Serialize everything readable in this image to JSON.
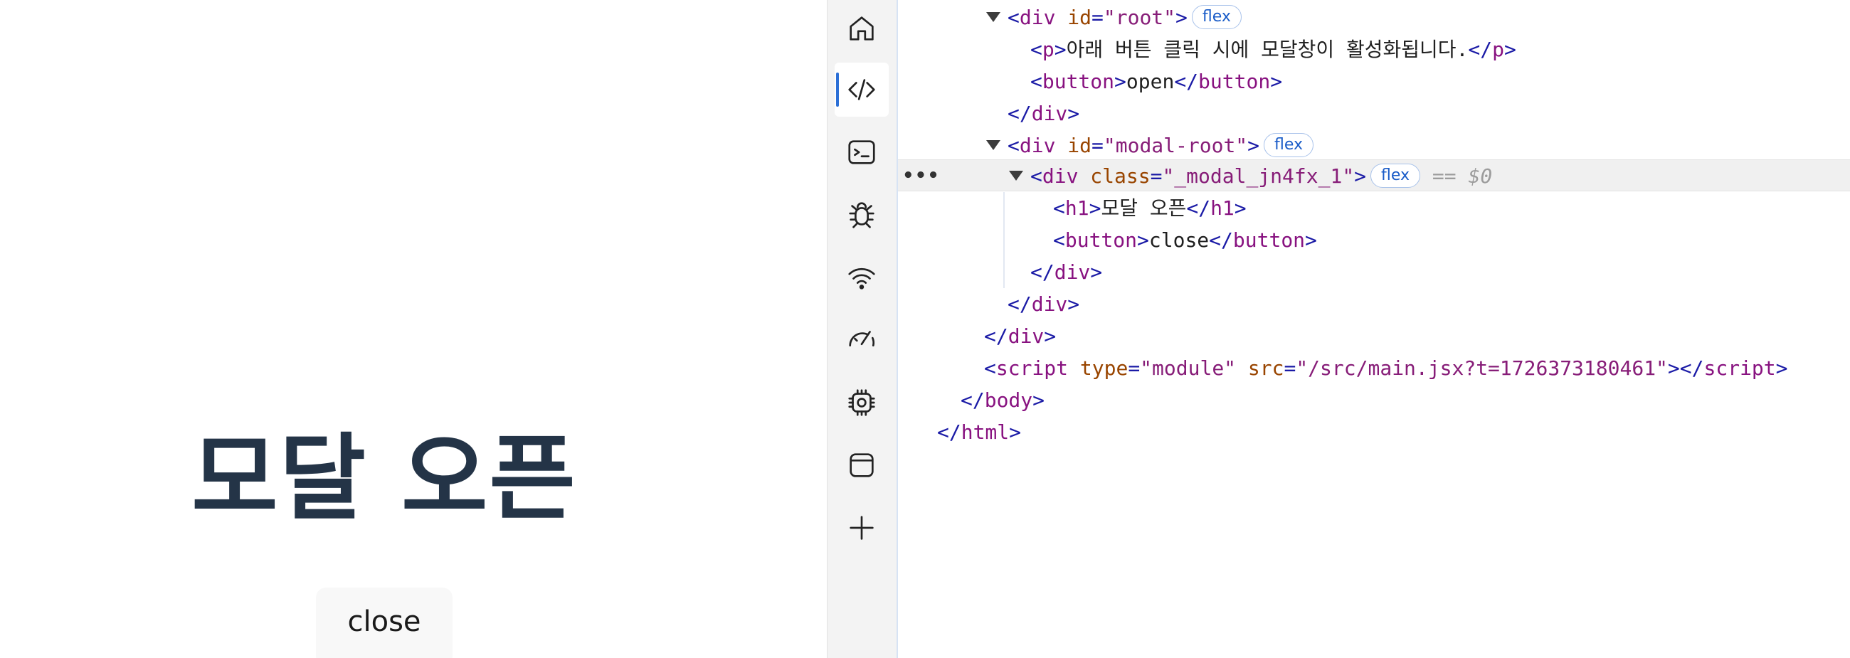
{
  "page": {
    "modal_title": "모달 오픈",
    "close_button": "close"
  },
  "activity_bar": {
    "items": [
      {
        "icon": "home-icon",
        "active": false
      },
      {
        "icon": "code-icon",
        "active": true
      },
      {
        "icon": "console-icon",
        "active": false
      },
      {
        "icon": "bug-icon",
        "active": false
      },
      {
        "icon": "wifi-icon",
        "active": false
      },
      {
        "icon": "performance-icon",
        "active": false
      },
      {
        "icon": "memory-chip-icon",
        "active": false
      },
      {
        "icon": "application-icon",
        "active": false
      },
      {
        "icon": "plus-icon",
        "active": false
      }
    ]
  },
  "elements": {
    "selected_marker": "== $0",
    "badge_label": "flex",
    "dots": "•••",
    "lines": {
      "root_open_id": "\"root\"",
      "p_text": "아래 버튼 클릭 시에 모달창이 활성화됩니다.",
      "button_open_text": "open",
      "modal_root_id": "\"modal-root\"",
      "modal_class": "\"_modal_jn4fx_1\"",
      "h1_text": "모달 오픈",
      "button_close_text": "close",
      "script_type": "\"module\"",
      "script_src": "\"/src/main.jsx?t=1726373180461\""
    }
  },
  "colors": {
    "title": "#243447",
    "accent": "#2b6fd6",
    "tag": "#1a1aa6",
    "tagname": "#881280",
    "attr": "#994500",
    "value": "#871d78"
  }
}
